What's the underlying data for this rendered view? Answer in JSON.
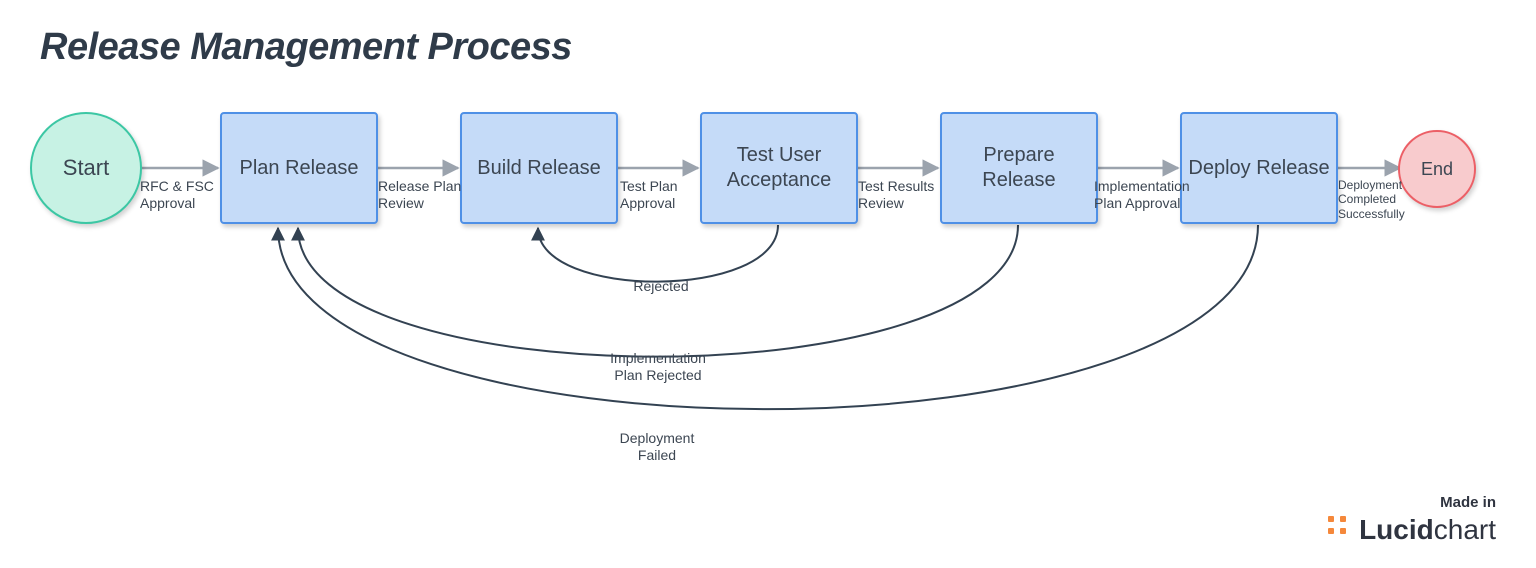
{
  "title": "Release Management Process",
  "nodes": {
    "start": {
      "label": "Start"
    },
    "plan": {
      "label": "Plan\nRelease"
    },
    "build": {
      "label": "Build\nRelease"
    },
    "test": {
      "label": "Test User\nAcceptance"
    },
    "prepare": {
      "label": "Prepare\nRelease"
    },
    "deploy": {
      "label": "Deploy\nRelease"
    },
    "end": {
      "label": "End"
    }
  },
  "edges": {
    "start_plan": "RFC & FSC\nApproval",
    "plan_build": "Release Plan\nReview",
    "build_test": "Test Plan\nApproval",
    "test_prepare": "Test Results\nReview",
    "prepare_deploy": "Implementation\nPlan Approval",
    "deploy_end": "Deployment\nCompleted\nSuccessfully",
    "test_build": "Rejected",
    "prepare_plan": "Implementation\nPlan Rejected",
    "deploy_plan": "Deployment\nFailed"
  },
  "footer": {
    "made_in": "Made in",
    "brand_bold": "Lucid",
    "brand_rest": "chart"
  },
  "colors": {
    "start_fill": "#c7f2e4",
    "start_stroke": "#3cc7a4",
    "end_fill": "#f8cbcd",
    "end_stroke": "#ec5f66",
    "rect_fill": "#c5dbf8",
    "rect_stroke": "#4f90e6",
    "straight_arrow": "#9ba3ad",
    "curved_arrow": "#334252",
    "brand_accent": "#f5883b"
  }
}
